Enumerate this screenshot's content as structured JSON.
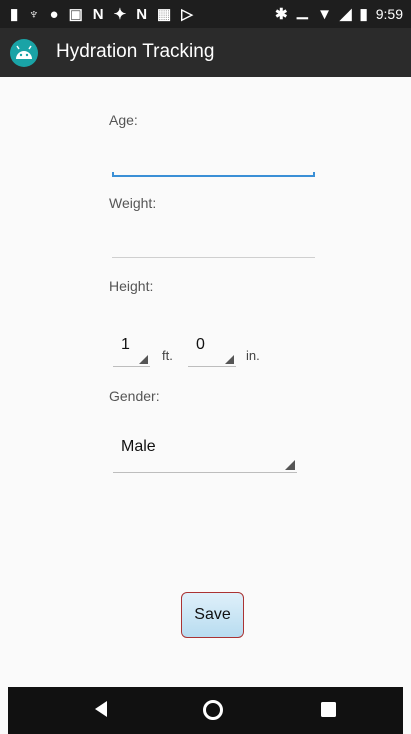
{
  "status_bar": {
    "time": "9:59"
  },
  "app_bar": {
    "title": "Hydration Tracking"
  },
  "form": {
    "age_label": "Age:",
    "age_value": "",
    "weight_label": "Weight:",
    "weight_value": "",
    "height_label": "Height:",
    "height_feet": "1",
    "height_feet_unit": "ft.",
    "height_inches": "0",
    "height_inches_unit": "in.",
    "gender_label": "Gender:",
    "gender_value": "Male",
    "save_label": "Save"
  },
  "colors": {
    "accent": "#3a8fd6",
    "app_bar": "#2b2b2b",
    "status_bar": "#1e1e1e",
    "icon_bg": "#1aa3a6",
    "save_border": "#aa3333"
  },
  "icons": {
    "status_left": [
      "notification-icon",
      "notification-icon",
      "notification-icon",
      "image-icon",
      "notification-icon",
      "notification-icon",
      "notification-icon",
      "notification-icon",
      "notification-icon"
    ],
    "status_right": [
      "bluetooth-icon",
      "do-not-disturb-icon",
      "wifi-icon",
      "signal-icon",
      "battery-icon"
    ],
    "nav": [
      "back-icon",
      "home-icon",
      "recents-icon"
    ]
  }
}
